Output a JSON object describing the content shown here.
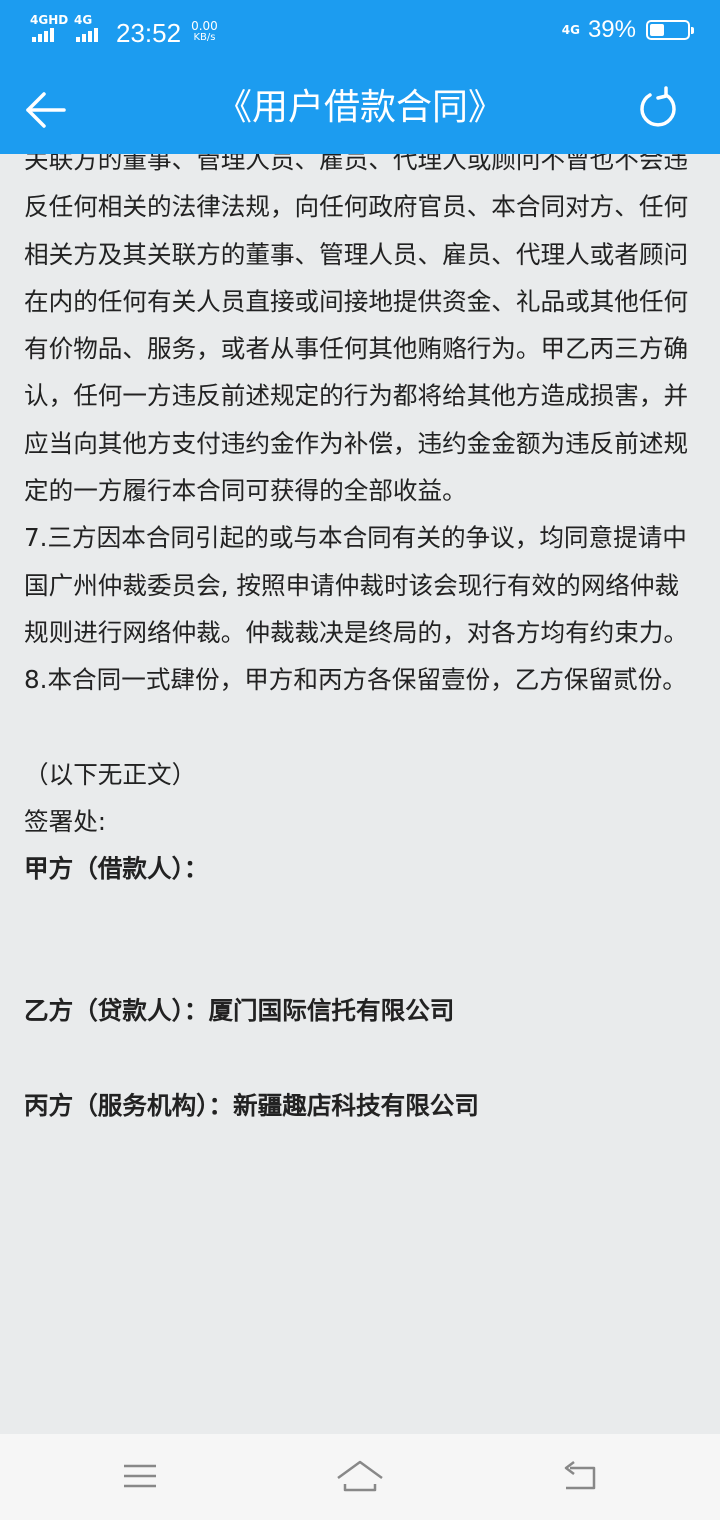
{
  "status_bar": {
    "sim1_label": "4GHD",
    "sim2_label": "4G",
    "time": "23:52",
    "speed_value": "0.00",
    "speed_unit": "KB/s",
    "network_label": "4G",
    "battery_percent": "39%",
    "battery_level": 0.39
  },
  "header": {
    "title": "《用户借款合同》",
    "back_icon": "arrow-left-icon",
    "refresh_icon": "refresh-icon",
    "background_color": "#1c9cf0"
  },
  "contract": {
    "paragraphs": [
      "关联方的董事、管理人员、雇员、代理人或顾问不曾也不会违反任何相关的法律法规，向任何政府官员、本合同对方、任何相关方及其关联方的董事、管理人员、雇员、代理人或者顾问在内的任何有关人员直接或间接地提供资金、礼品或其他任何有价物品、服务，或者从事任何其他贿赂行为。甲乙丙三方确认，任何一方违反前述规定的行为都将给其他方造成损害，并应当向其他方支付违约金作为补偿，违约金金额为违反前述规定的一方履行本合同可获得的全部收益。",
      "7.三方因本合同引起的或与本合同有关的争议，均同意提请中国广州仲裁委员会, 按照申请仲裁时该会现行有效的网络仲裁规则进行网络仲裁。仲裁裁决是终局的，对各方均有约束力。",
      "8.本合同一式肆份，甲方和丙方各保留壹份，乙方保留贰份。"
    ],
    "no_more_text": "（以下无正文）",
    "signature_label": "签署处:",
    "party_a": "甲方（借款人）：",
    "party_b": "乙方（贷款人）：厦门国际信托有限公司",
    "party_c": "丙方（服务机构）：新疆趣店科技有限公司"
  },
  "nav_bar": {
    "menu_icon": "menu-icon",
    "home_icon": "home-icon",
    "back_icon": "back-icon"
  }
}
